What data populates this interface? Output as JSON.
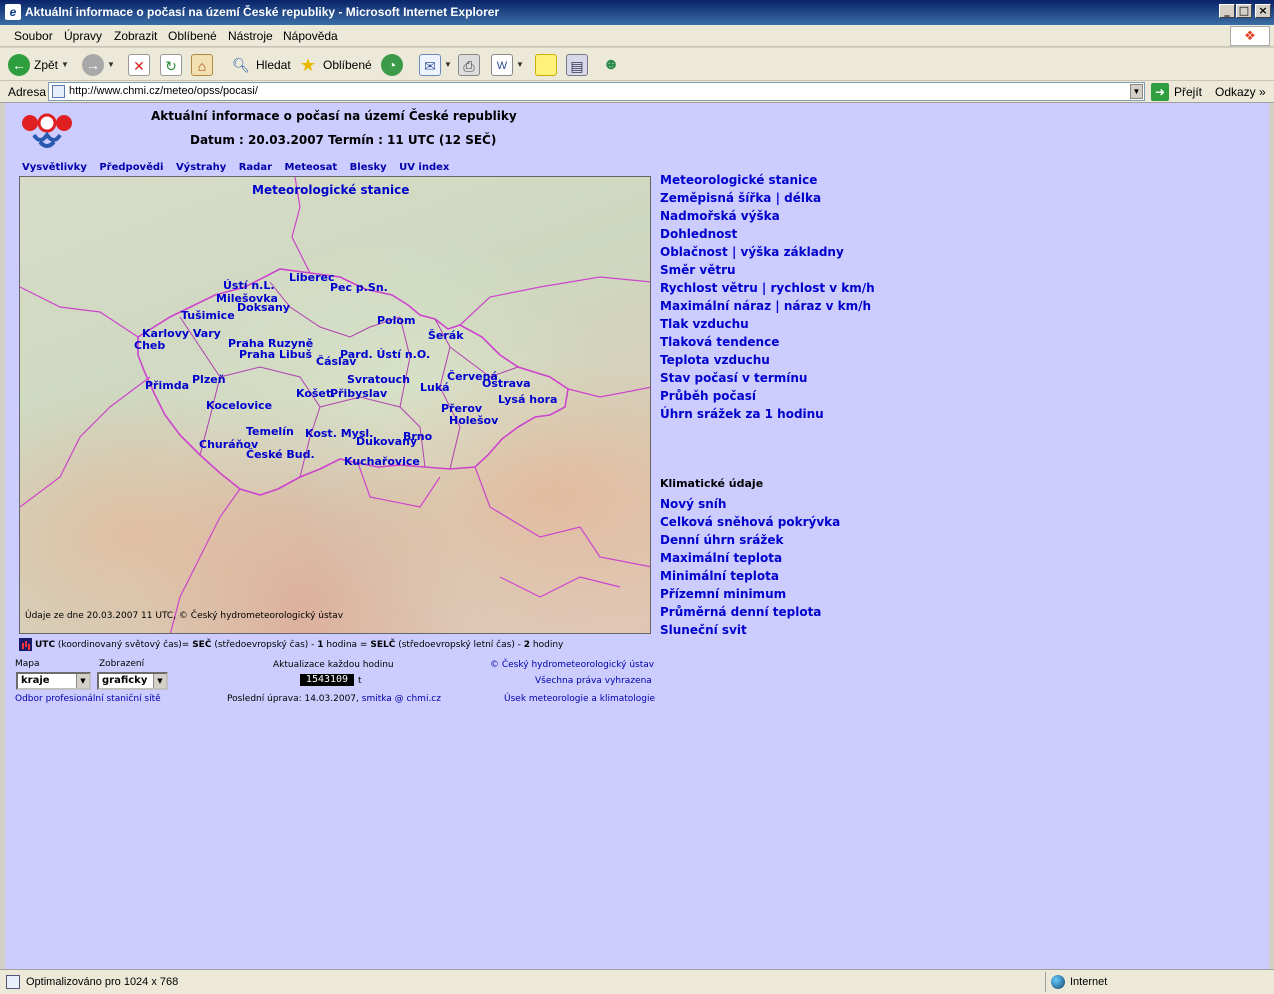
{
  "window": {
    "title": "Aktuální informace o počasí na území České republiky - Microsoft Internet Explorer",
    "controls": [
      "_",
      "□",
      "×"
    ]
  },
  "menu": [
    "Soubor",
    "Úpravy",
    "Zobrazit",
    "Oblíbené",
    "Nástroje",
    "Nápověda"
  ],
  "toolbar": {
    "back_label": "Zpět",
    "search_label": "Hledat",
    "favorites_label": "Oblíbené"
  },
  "address": {
    "label": "Adresa",
    "url": "http://www.chmi.cz/meteo/opss/pocasi/",
    "go_label": "Přejít",
    "links_label": "Odkazy"
  },
  "page": {
    "title": "Aktuální informace o počasí na území České republiky",
    "datum": "Datum : 20.03.2007 Termín : 11 UTC (12 SEČ)",
    "nav": [
      "Vysvětlivky",
      "Předpovědi",
      "Výstrahy",
      "Radar",
      "Meteosat",
      "Blesky",
      "UV index"
    ],
    "map": {
      "heading": "Meteorologické stanice",
      "footer": "Údaje ze dne 20.03.2007 11 UTC, © Český hydrometeorologický ústav",
      "stations": [
        "Liberec",
        "Ústí n.L.",
        "Pec p.Sn.",
        "Milešovka",
        "Doksany",
        "Tušimice",
        "Polom",
        "Šerák",
        "Karlovy Vary",
        "Cheb",
        "Praha Ruzyně",
        "Praha Libuš",
        "Pard. Ústí n.O.",
        "Čáslav",
        "Červená",
        "Ostrava",
        "Svratouch",
        "Přimda",
        "Plzeň",
        "Košetice",
        "Přibyslav",
        "Luká",
        "Lysá hora",
        "Kocelovice",
        "Přerov",
        "Holešov",
        "Temelín",
        "Kostelní Myslová",
        "Brno",
        "Churáňov",
        "Dukovany",
        "České Bud.",
        "Kuchařovice"
      ],
      "station_texts": [
        "Liberec",
        "Ústí n.L.",
        "Pec p.Sn.",
        "Milešovka",
        "Doksany",
        "Tušimice",
        "Polom",
        "Šerák",
        "Karlovy Vary",
        "Cheb",
        "Praha Ruzyně",
        "Praha Libuš",
        "Pard. Ústí n.O.",
        "Čáslav",
        "Červená",
        "Ostrava",
        "Svratouch",
        "Přimda",
        "Plzeň",
        "Košet.",
        "Přibyslav",
        "Luká",
        "Lysá hora",
        "Kocelovice",
        "Přerov",
        "Holešov",
        "Temelín",
        "Kost. Mysl.",
        "Brno",
        "Churáňov",
        "Dukovany",
        "České Bud.",
        "Kuchařovice"
      ]
    },
    "utc_note": {
      "utc": "UTC",
      "text1": " (koordinovaný světový čas)= ",
      "sec": "SEČ",
      "text2": " (středoevropský čas) - ",
      "one": "1",
      "text3": " hodina = ",
      "selc": "SELČ",
      "text4": " (středoevropský letní čas) - ",
      "two": "2",
      "text5": " hodiny"
    },
    "controls": {
      "mapa_label": "Mapa",
      "mapa_value": "kraje",
      "zobrazeni_label": "Zobrazení",
      "zobrazeni_value": "graficky",
      "update_label": "Aktualizace každou hodinu",
      "counter_value": "1543109",
      "counter_suffix": "t",
      "last_update_prefix": "Poslední úprava: 14.03.2007, ",
      "last_update_link": "smitka @ chmi.cz",
      "odbor_link": "Odbor profesionální staniční sítě",
      "copyright": "© Český hydrometeorologický ústav",
      "rights": "Všechna práva vyhrazena",
      "usek_link": "Úsek meteorologie a klimatologie"
    },
    "right_links": [
      "Meteorologické stanice",
      "Zeměpisná šířka | délka",
      "Nadmořská výška",
      "Dohlednost",
      "Oblačnost | výška základny",
      "Směr větru",
      "Rychlost větru | rychlost v km/h",
      "Maximální náraz | náraz v km/h",
      "Tlak vzduchu",
      "Tlaková tendence",
      "Teplota vzduchu",
      "Stav počasí v termínu",
      "Průběh počasí",
      "Úhrn srážek za 1 hodinu"
    ],
    "klim_heading": "Klimatické údaje",
    "klim_links": [
      "Nový sníh",
      "Celková sněhová pokrývka",
      "Denní úhrn srážek",
      "Maximální teplota",
      "Minimální teplota",
      "Přízemní minimum",
      "Průměrná denní teplota",
      "Sluneční svit"
    ]
  },
  "status": {
    "text": "Optimalizováno pro 1024 x 768",
    "zone": "Internet"
  },
  "colors": {
    "page_bg": "#ccccff",
    "link": "#0000cc",
    "border_line": "#cc44cc"
  }
}
